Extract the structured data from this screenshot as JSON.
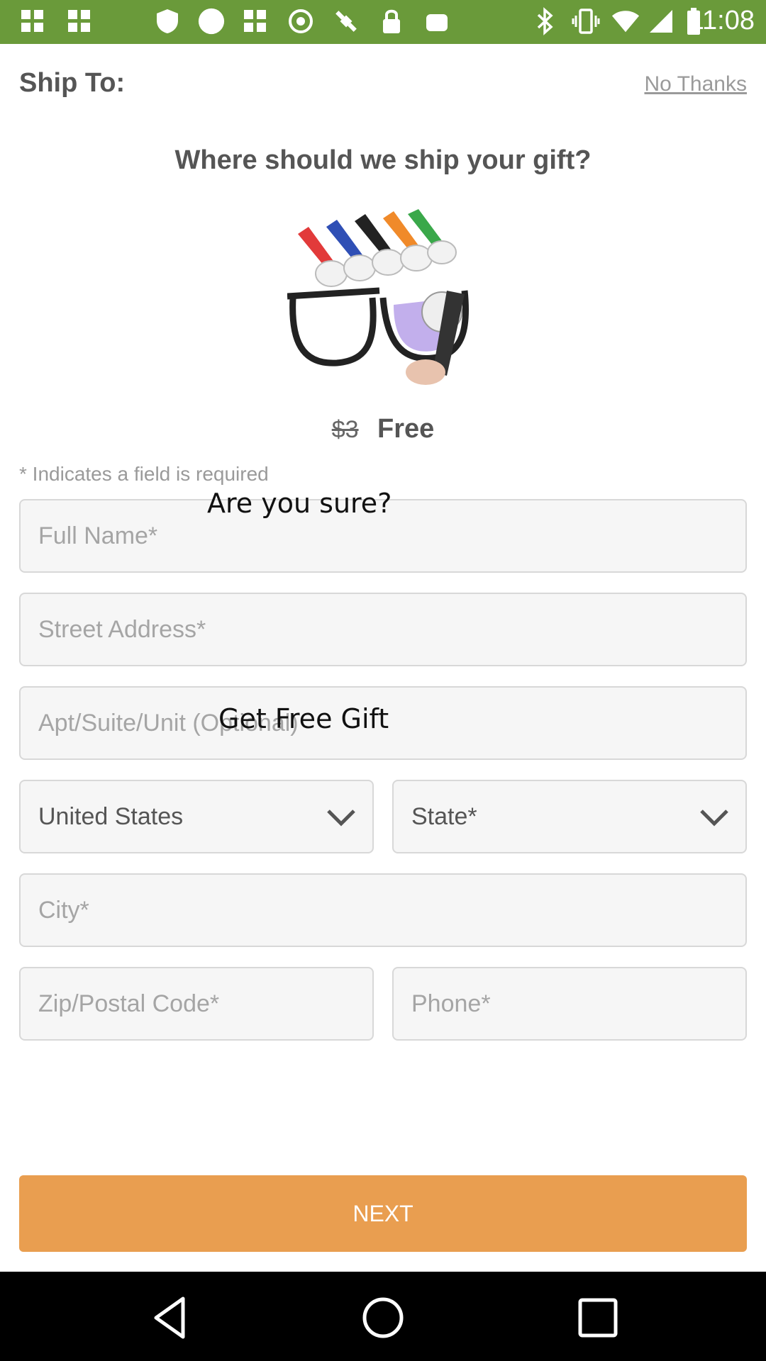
{
  "status_bar": {
    "time": "11:08",
    "left_icons": [
      "grid-icon",
      "grid-icon",
      "shield-icon",
      "circle-icon",
      "grid-icon",
      "gear-icon",
      "fake-gps-icon",
      "lock-icon",
      "android-icon"
    ],
    "right_icons": [
      "bluetooth-icon",
      "vibrate-icon",
      "wifi-icon",
      "signal-icon",
      "battery-icon"
    ],
    "background_color": "#6a9a3a"
  },
  "header": {
    "title": "Ship To:",
    "dismiss_link": "No Thanks"
  },
  "main": {
    "headline": "Where should we ship your gift?",
    "product_image_icon": "glasses-cleaner-image",
    "old_price": "$3",
    "new_price": "Free",
    "required_note": "* Indicates a field is required"
  },
  "form": {
    "full_name_placeholder": "Full Name*",
    "street_placeholder": "Street Address*",
    "apt_placeholder": "Apt/Suite/Unit (Optional)",
    "country_value": "United States",
    "state_placeholder": "State*",
    "city_placeholder": "City*",
    "zip_placeholder": "Zip/Postal Code*",
    "phone_placeholder": "Phone*"
  },
  "overlay": {
    "confirm_text": "Are you sure?",
    "gift_text": "Get Free Gift"
  },
  "footer": {
    "next_label": "NEXT",
    "accent_color": "#e99e50"
  },
  "nav_bar": {
    "buttons": [
      "back-icon",
      "home-icon",
      "recents-icon"
    ]
  }
}
